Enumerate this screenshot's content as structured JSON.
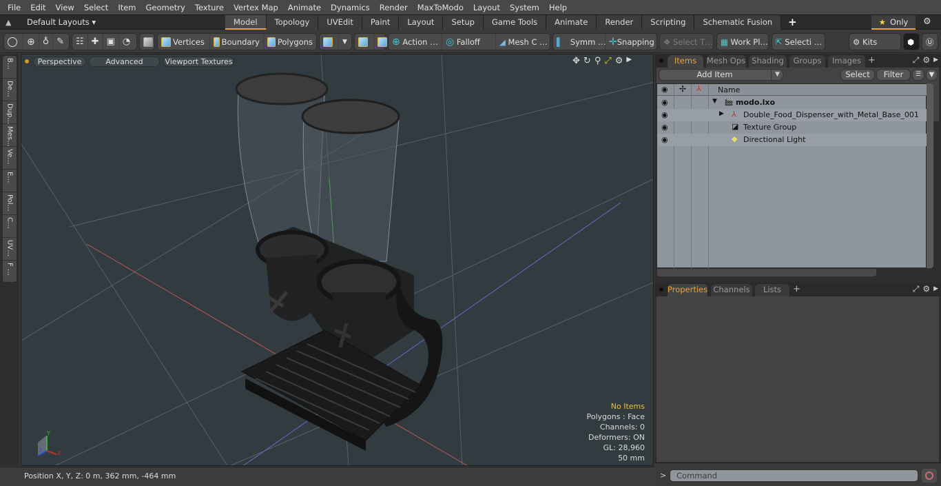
{
  "menubar": [
    "File",
    "Edit",
    "View",
    "Select",
    "Item",
    "Geometry",
    "Texture",
    "Vertex Map",
    "Animate",
    "Dynamics",
    "Render",
    "MaxToModo",
    "Layout",
    "System",
    "Help"
  ],
  "layoutbar": {
    "layouts_label": "Default Layouts ▾",
    "tabs": [
      "Model",
      "Topology",
      "UVEdit",
      "Paint",
      "Layout",
      "Setup",
      "Game Tools",
      "Animate",
      "Render",
      "Scripting",
      "Schematic Fusion"
    ],
    "active_tab": "Model",
    "add_tab": "+",
    "only_label": "Only"
  },
  "toolbar": {
    "vertices": "Vertices",
    "boundary": "Boundary",
    "polygons": "Polygons",
    "action": "Action",
    "falloff": "Falloff",
    "mesh_c": "Mesh C …",
    "symm": "Symm …",
    "snapping": "Snapping",
    "select_t": "Select T…",
    "work_pl": "Work Pl…",
    "selecti": "Selecti …",
    "kits": "Kits"
  },
  "left_tabs": [
    "B…",
    "De…",
    "Dup…",
    "Mes…",
    "Ve…",
    "E…",
    "Pol…",
    "C…",
    "UV…",
    "F …"
  ],
  "viewport": {
    "view_mode": "Perspective",
    "shading": "Advanced",
    "textures": "Viewport Textures",
    "hud": {
      "selection": "No Items",
      "polygons": "Polygons : Face",
      "channels": "Channels: 0",
      "deformers": "Deformers: ON",
      "gl": "GL: 28,960",
      "scale": "50 mm"
    }
  },
  "status": {
    "position": "Position X, Y, Z:   0 m, 362 mm, -464 mm"
  },
  "items_panel": {
    "tabs": [
      "Items",
      "Mesh Ops",
      "Shading",
      "Groups",
      "Images"
    ],
    "active_tab": "Items",
    "add_item": "Add Item",
    "select": "Select",
    "filter": "Filter",
    "column_name": "Name",
    "tree": [
      {
        "name": "modo.lxo",
        "icon": "scene-icon",
        "level": 0,
        "expanded": true
      },
      {
        "name": "Double_Food_Dispenser_with_Metal_Base_001",
        "icon": "mesh-locator-icon",
        "level": 1,
        "expanded": false
      },
      {
        "name": "Texture Group",
        "icon": "texture-group-icon",
        "level": 1
      },
      {
        "name": "Directional Light",
        "icon": "light-icon",
        "level": 1
      }
    ]
  },
  "properties_panel": {
    "tabs": [
      "Properties",
      "Channels",
      "Lists"
    ],
    "active_tab": "Properties"
  },
  "command": {
    "prompt": ">",
    "placeholder": "Command"
  },
  "colors": {
    "accent": "#e8a33c",
    "viewport_bg": "#323b40",
    "tree_bg": "#8f969d"
  }
}
